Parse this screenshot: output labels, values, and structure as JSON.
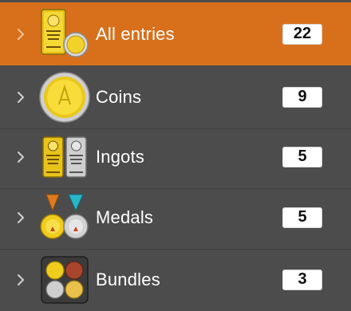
{
  "colors": {
    "background": "#4c4c4c",
    "selected": "#d8701b",
    "gold": "#f2cf1a",
    "silver": "#c9c9c9",
    "bronze": "#c77a3a"
  },
  "rows": [
    {
      "label": "All entries",
      "count": "22",
      "icon": "gold-ingot-and-coin-icon",
      "selected": true
    },
    {
      "label": "Coins",
      "count": "9",
      "icon": "gold-coin-icon",
      "selected": false
    },
    {
      "label": "Ingots",
      "count": "5",
      "icon": "gold-and-silver-ingots-icon",
      "selected": false
    },
    {
      "label": "Medals",
      "count": "5",
      "icon": "medals-icon",
      "selected": false
    },
    {
      "label": "Bundles",
      "count": "3",
      "icon": "coin-bundle-icon",
      "selected": false
    }
  ]
}
